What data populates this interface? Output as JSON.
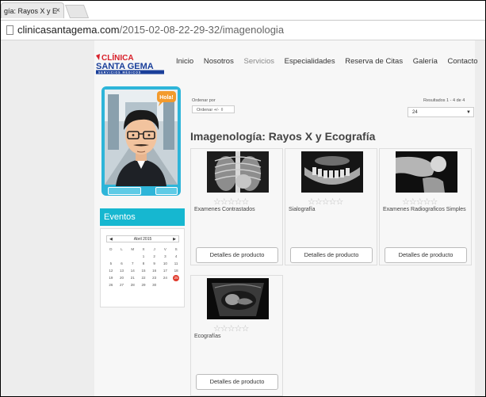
{
  "browser": {
    "tab_title": "gía: Rayos X y E",
    "tab_close": "×",
    "url_host": "clinicasantagema.com",
    "url_path": "/2015-02-08-22-29-32/imagenologia"
  },
  "header": {
    "logo_line1": "CLÍNICA",
    "logo_line2": "SANTA GEMA",
    "logo_line3": "SERVICIOS MÉDICOS",
    "nav": [
      "Inicio",
      "Nosotros",
      "Servicios",
      "Especialidades",
      "Reserva de Citas",
      "Galería",
      "Contacto"
    ]
  },
  "avatar": {
    "bubble": "Hola!"
  },
  "sidebar": {
    "eventos_title": "Eventos",
    "calendar": {
      "month": "Abril 2015",
      "prev": "◀",
      "next": "▶",
      "weekdays": [
        "D",
        "L",
        "M",
        "X",
        "J",
        "V",
        "S"
      ],
      "weeks": [
        [
          "",
          "",
          "",
          "1",
          "2",
          "3",
          "4"
        ],
        [
          "5",
          "6",
          "7",
          "8",
          "9",
          "10",
          "11"
        ],
        [
          "12",
          "13",
          "14",
          "15",
          "16",
          "17",
          "18"
        ],
        [
          "19",
          "20",
          "21",
          "22",
          "23",
          "24",
          "25"
        ],
        [
          "26",
          "27",
          "28",
          "29",
          "30",
          "",
          ""
        ]
      ],
      "today": "25"
    }
  },
  "listing": {
    "sort_label": "Ordenar por",
    "sort_button": "Ordenar +/- ⇳",
    "results": "Resultados 1 - 4 de 4",
    "per_page": "24",
    "per_page_arrow": "▼",
    "title": "Imagenología: Rayos X y Ecografía",
    "stars": "☆☆☆☆☆",
    "detail_button": "Detalles de producto",
    "products": [
      {
        "name": "Examenes Contrastados"
      },
      {
        "name": "Sialografía"
      },
      {
        "name": "Examenes Radiograficos Simples"
      },
      {
        "name": "Ecografías"
      }
    ]
  },
  "colors": {
    "accent": "#16b7d0",
    "today_marker": "#e03a2b",
    "logo_red": "#d8202a",
    "logo_blue": "#1a3f9a"
  }
}
